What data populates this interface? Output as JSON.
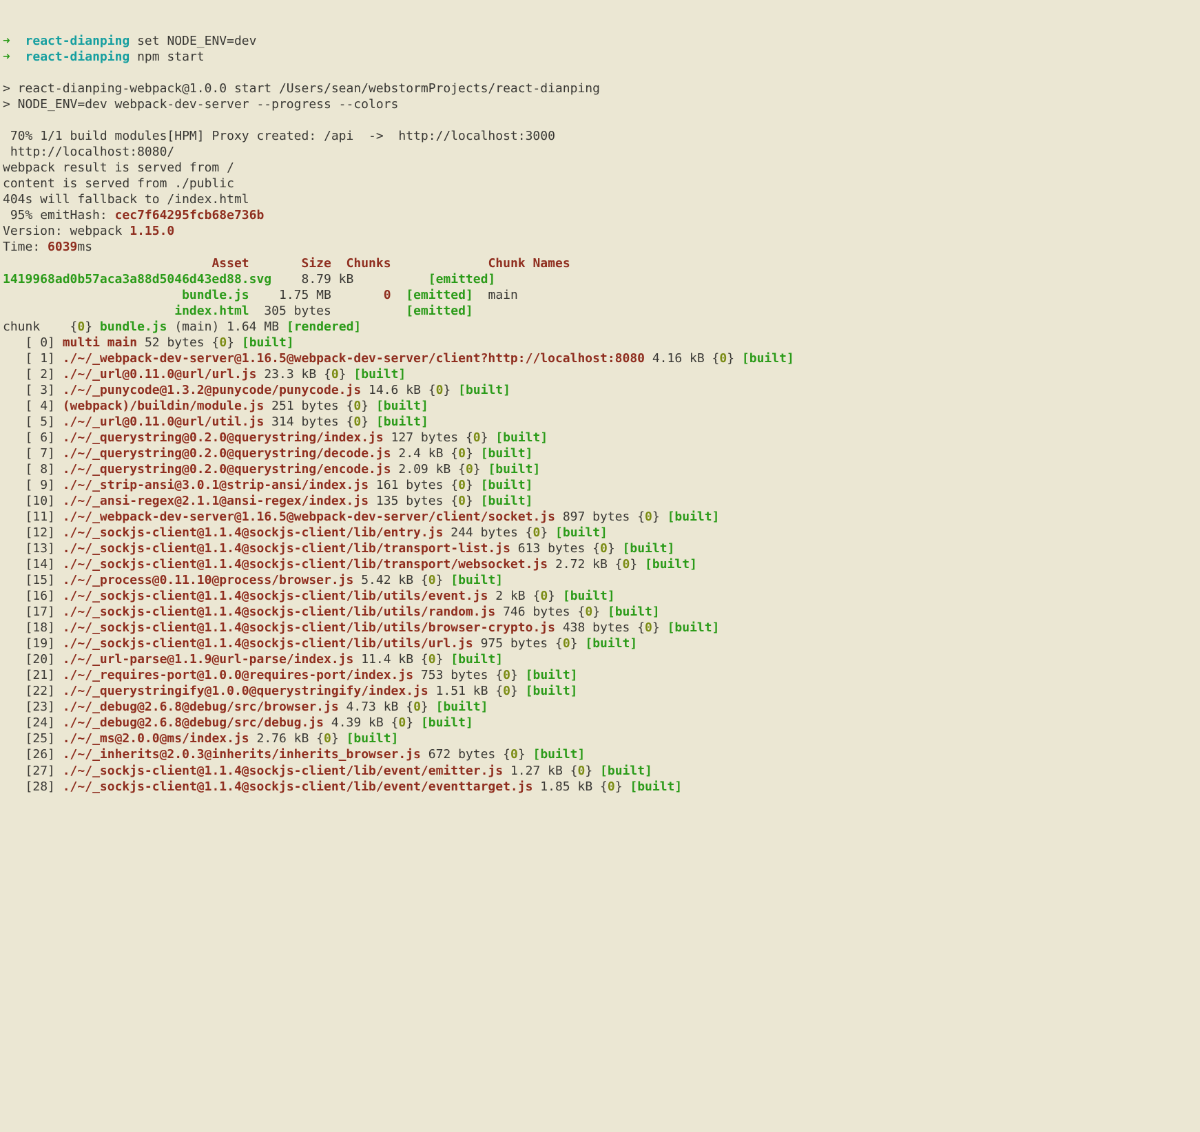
{
  "prompt": {
    "arrow": "➜",
    "project": "react-dianping"
  },
  "commands": [
    "set NODE_ENV=dev",
    "npm start"
  ],
  "startLines": [
    "> react-dianping-webpack@1.0.0 start /Users/sean/webstormProjects/react-dianping",
    "> NODE_ENV=dev webpack-dev-server --progress --colors"
  ],
  "progress": {
    "proxy": "70% 1/1 build modules[HPM] Proxy created: /api  ->  http://localhost:3000",
    "localUrl": "http://localhost:8080/",
    "servedFrom": "webpack result is served from /",
    "contentFrom": "content is served from ./public",
    "fallback": "404s will fallback to /index.html",
    "emitLabel": "95% emitHash:",
    "emitHash": "cec7f64295fcb68e736b",
    "versionLabel": "Version: webpack",
    "version": "1.15.0",
    "timeLabel": "Time:",
    "time": "6039",
    "timeUnit": "ms"
  },
  "table": {
    "headers": {
      "asset": "Asset",
      "size": "Size",
      "chunks": "Chunks",
      "chunkNames": "Chunk Names"
    },
    "rows": [
      {
        "asset": "1419968ad0b57aca3a88d5046d43ed88.svg",
        "size": "8.79 kB",
        "status": "[emitted]"
      },
      {
        "asset": "bundle.js",
        "size": "1.75 MB",
        "chunk": "0",
        "status": "[emitted]",
        "chunkName": "main"
      },
      {
        "asset": "index.html",
        "size": "305 bytes",
        "status": "[emitted]"
      }
    ]
  },
  "chunkLine": {
    "label": "chunk",
    "id": "0",
    "name": "bundle.js",
    "main": "(main) 1.64 MB",
    "rendered": "[rendered]"
  },
  "modules": [
    {
      "idx": 0,
      "name": "multi main",
      "size": "52 bytes",
      "chunk": "0",
      "status": "[built]"
    },
    {
      "idx": 1,
      "name": "./~/_webpack-dev-server@1.16.5@webpack-dev-server/client?http://localhost:8080",
      "size": "4.16 kB",
      "chunk": "0",
      "status": "[built]"
    },
    {
      "idx": 2,
      "name": "./~/_url@0.11.0@url/url.js",
      "size": "23.3 kB",
      "chunk": "0",
      "status": "[built]"
    },
    {
      "idx": 3,
      "name": "./~/_punycode@1.3.2@punycode/punycode.js",
      "size": "14.6 kB",
      "chunk": "0",
      "status": "[built]"
    },
    {
      "idx": 4,
      "name": "(webpack)/buildin/module.js",
      "size": "251 bytes",
      "chunk": "0",
      "status": "[built]"
    },
    {
      "idx": 5,
      "name": "./~/_url@0.11.0@url/util.js",
      "size": "314 bytes",
      "chunk": "0",
      "status": "[built]"
    },
    {
      "idx": 6,
      "name": "./~/_querystring@0.2.0@querystring/index.js",
      "size": "127 bytes",
      "chunk": "0",
      "status": "[built]"
    },
    {
      "idx": 7,
      "name": "./~/_querystring@0.2.0@querystring/decode.js",
      "size": "2.4 kB",
      "chunk": "0",
      "status": "[built]"
    },
    {
      "idx": 8,
      "name": "./~/_querystring@0.2.0@querystring/encode.js",
      "size": "2.09 kB",
      "chunk": "0",
      "status": "[built]"
    },
    {
      "idx": 9,
      "name": "./~/_strip-ansi@3.0.1@strip-ansi/index.js",
      "size": "161 bytes",
      "chunk": "0",
      "status": "[built]"
    },
    {
      "idx": 10,
      "name": "./~/_ansi-regex@2.1.1@ansi-regex/index.js",
      "size": "135 bytes",
      "chunk": "0",
      "status": "[built]"
    },
    {
      "idx": 11,
      "name": "./~/_webpack-dev-server@1.16.5@webpack-dev-server/client/socket.js",
      "size": "897 bytes",
      "chunk": "0",
      "status": "[built]"
    },
    {
      "idx": 12,
      "name": "./~/_sockjs-client@1.1.4@sockjs-client/lib/entry.js",
      "size": "244 bytes",
      "chunk": "0",
      "status": "[built]"
    },
    {
      "idx": 13,
      "name": "./~/_sockjs-client@1.1.4@sockjs-client/lib/transport-list.js",
      "size": "613 bytes",
      "chunk": "0",
      "status": "[built]"
    },
    {
      "idx": 14,
      "name": "./~/_sockjs-client@1.1.4@sockjs-client/lib/transport/websocket.js",
      "size": "2.72 kB",
      "chunk": "0",
      "status": "[built]"
    },
    {
      "idx": 15,
      "name": "./~/_process@0.11.10@process/browser.js",
      "size": "5.42 kB",
      "chunk": "0",
      "status": "[built]"
    },
    {
      "idx": 16,
      "name": "./~/_sockjs-client@1.1.4@sockjs-client/lib/utils/event.js",
      "size": "2 kB",
      "chunk": "0",
      "status": "[built]"
    },
    {
      "idx": 17,
      "name": "./~/_sockjs-client@1.1.4@sockjs-client/lib/utils/random.js",
      "size": "746 bytes",
      "chunk": "0",
      "status": "[built]"
    },
    {
      "idx": 18,
      "name": "./~/_sockjs-client@1.1.4@sockjs-client/lib/utils/browser-crypto.js",
      "size": "438 bytes",
      "chunk": "0",
      "status": "[built]"
    },
    {
      "idx": 19,
      "name": "./~/_sockjs-client@1.1.4@sockjs-client/lib/utils/url.js",
      "size": "975 bytes",
      "chunk": "0",
      "status": "[built]"
    },
    {
      "idx": 20,
      "name": "./~/_url-parse@1.1.9@url-parse/index.js",
      "size": "11.4 kB",
      "chunk": "0",
      "status": "[built]"
    },
    {
      "idx": 21,
      "name": "./~/_requires-port@1.0.0@requires-port/index.js",
      "size": "753 bytes",
      "chunk": "0",
      "status": "[built]"
    },
    {
      "idx": 22,
      "name": "./~/_querystringify@1.0.0@querystringify/index.js",
      "size": "1.51 kB",
      "chunk": "0",
      "status": "[built]"
    },
    {
      "idx": 23,
      "name": "./~/_debug@2.6.8@debug/src/browser.js",
      "size": "4.73 kB",
      "chunk": "0",
      "status": "[built]"
    },
    {
      "idx": 24,
      "name": "./~/_debug@2.6.8@debug/src/debug.js",
      "size": "4.39 kB",
      "chunk": "0",
      "status": "[built]"
    },
    {
      "idx": 25,
      "name": "./~/_ms@2.0.0@ms/index.js",
      "size": "2.76 kB",
      "chunk": "0",
      "status": "[built]"
    },
    {
      "idx": 26,
      "name": "./~/_inherits@2.0.3@inherits/inherits_browser.js",
      "size": "672 bytes",
      "chunk": "0",
      "status": "[built]"
    },
    {
      "idx": 27,
      "name": "./~/_sockjs-client@1.1.4@sockjs-client/lib/event/emitter.js",
      "size": "1.27 kB",
      "chunk": "0",
      "status": "[built]"
    },
    {
      "idx": 28,
      "name": "./~/_sockjs-client@1.1.4@sockjs-client/lib/event/eventtarget.js",
      "size": "1.85 kB",
      "chunk": "0",
      "status": "[built]"
    }
  ]
}
